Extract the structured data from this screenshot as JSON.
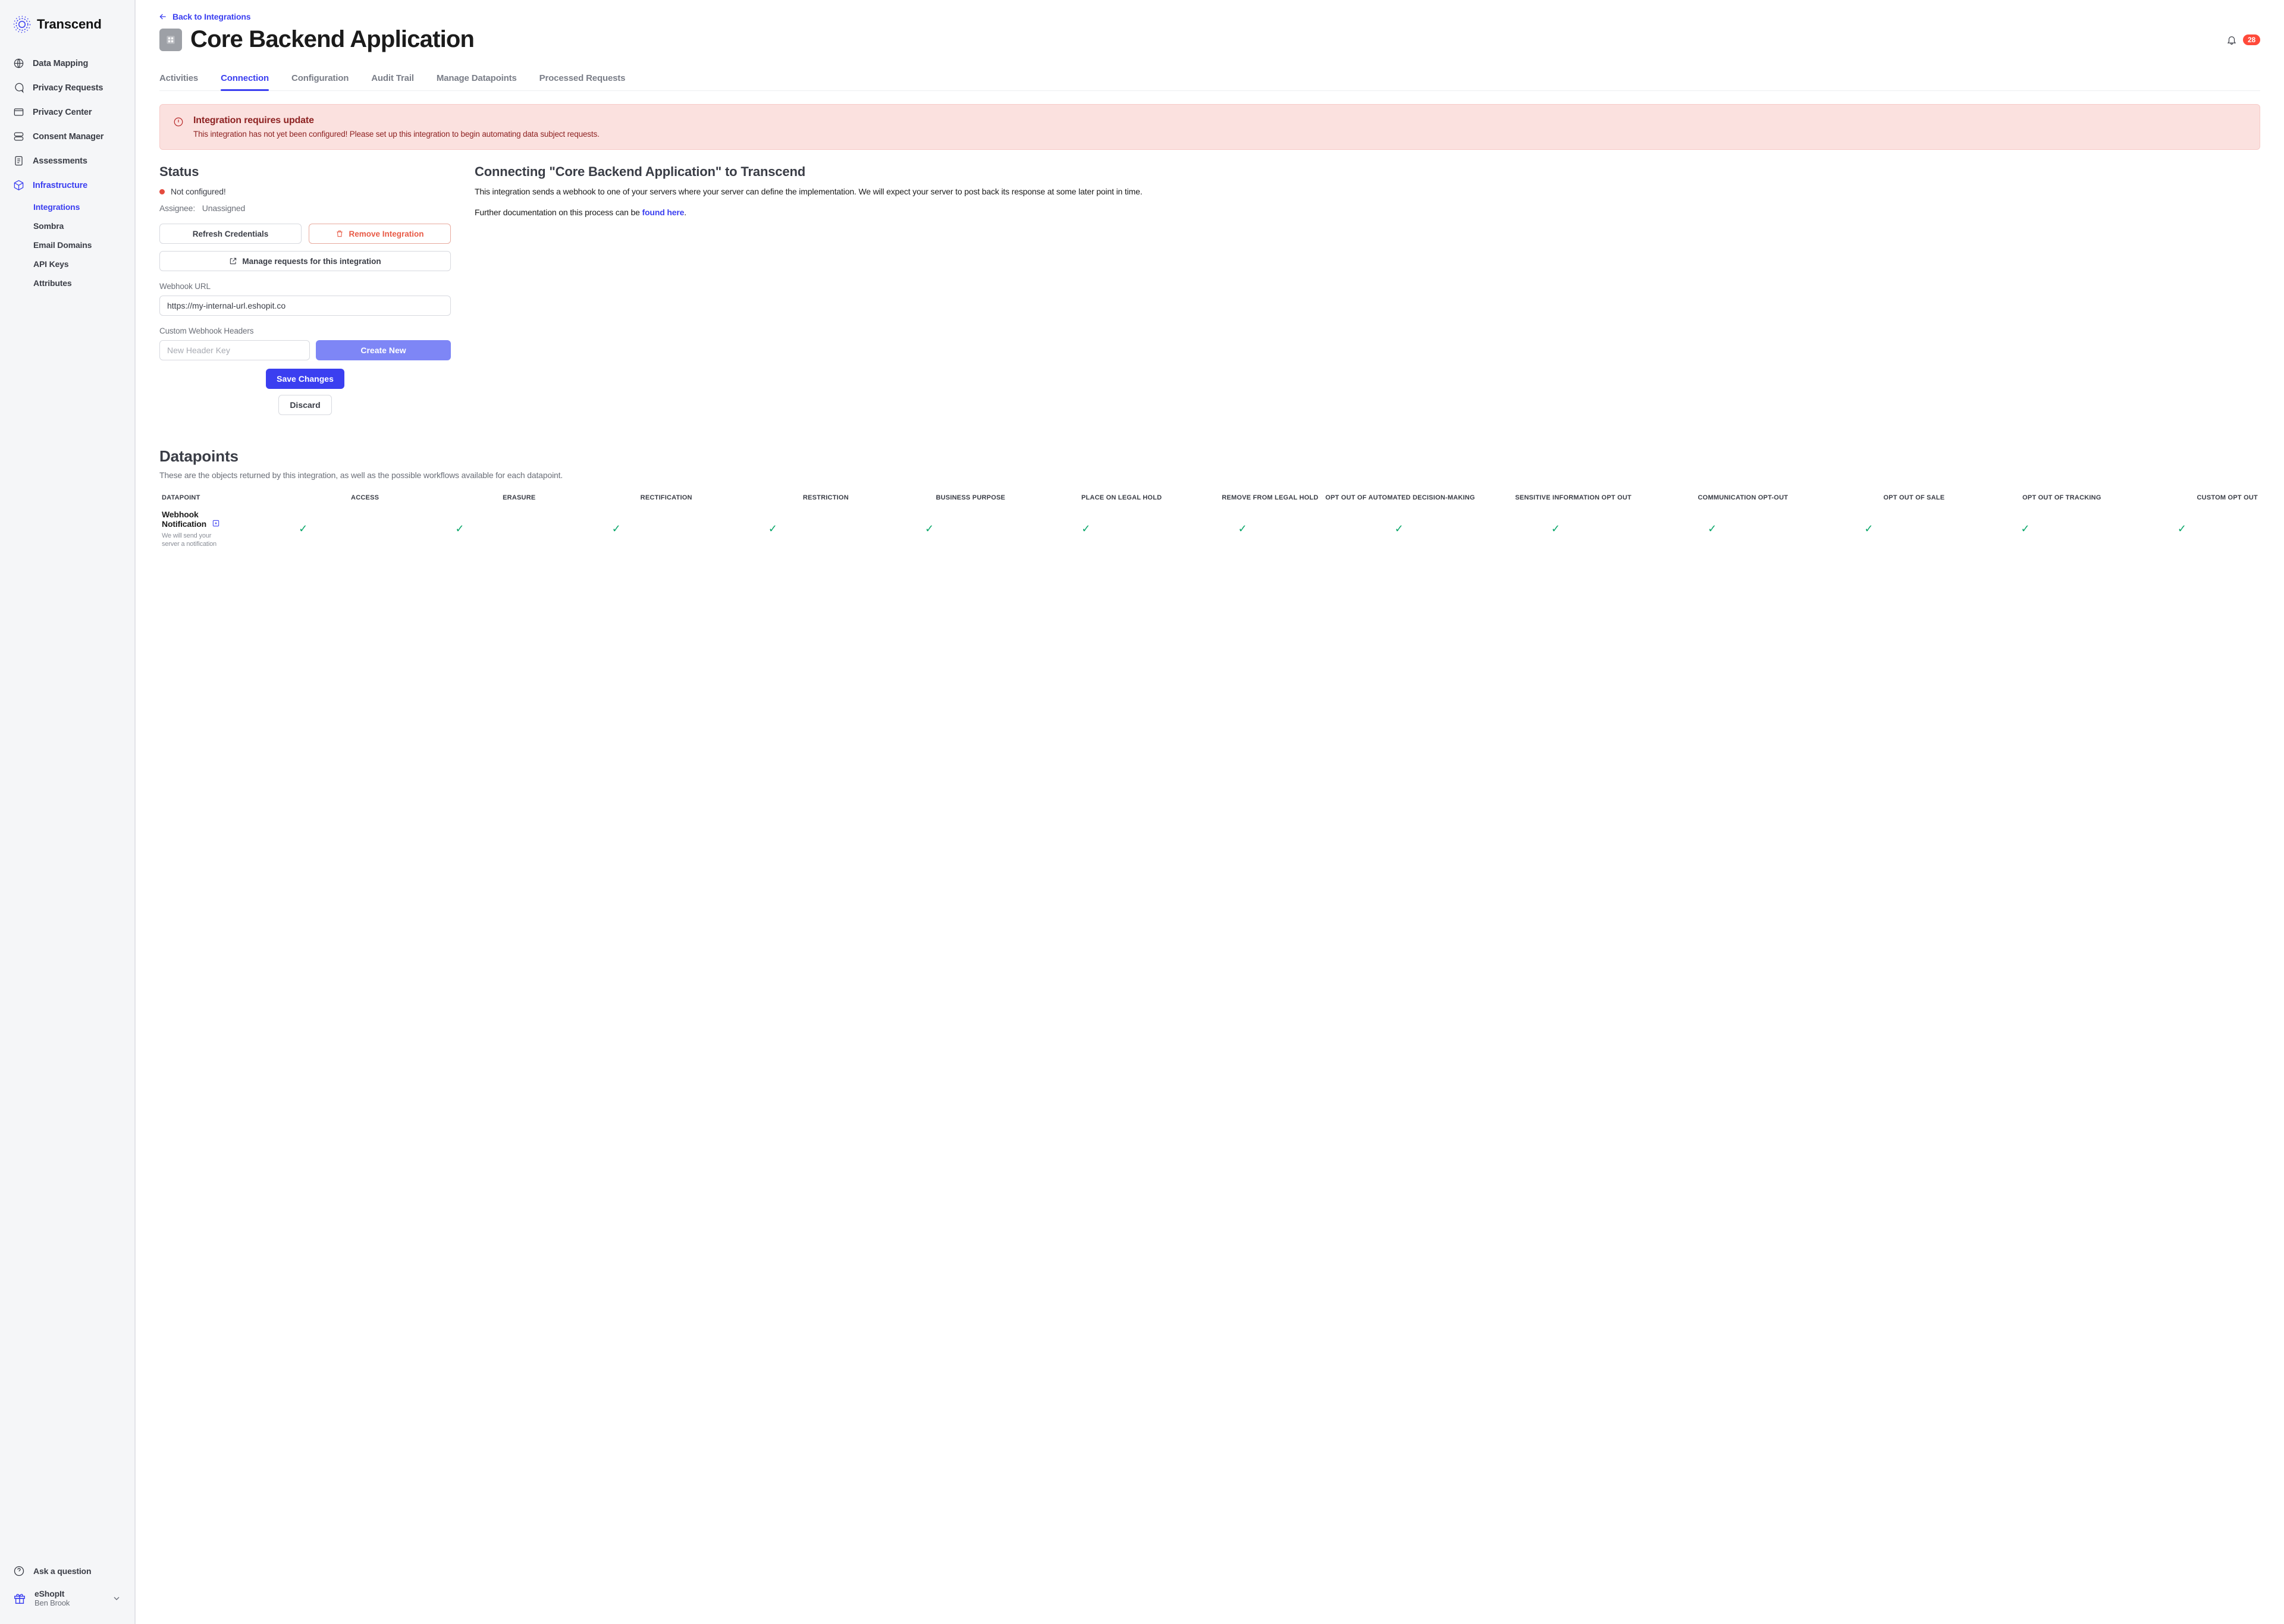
{
  "brand": "Transcend",
  "sidebar": {
    "items": [
      {
        "label": "Data Mapping"
      },
      {
        "label": "Privacy Requests"
      },
      {
        "label": "Privacy Center"
      },
      {
        "label": "Consent Manager"
      },
      {
        "label": "Assessments"
      },
      {
        "label": "Infrastructure"
      }
    ],
    "sub": [
      {
        "label": "Integrations"
      },
      {
        "label": "Sombra"
      },
      {
        "label": "Email Domains"
      },
      {
        "label": "API Keys"
      },
      {
        "label": "Attributes"
      }
    ],
    "ask": "Ask a question",
    "org": "eShopIt",
    "user": "Ben Brook"
  },
  "backlink": "Back to Integrations",
  "page_title": "Core Backend Application",
  "notif_count": "28",
  "tabs": [
    "Activities",
    "Connection",
    "Configuration",
    "Audit Trail",
    "Manage Datapoints",
    "Processed Requests"
  ],
  "alert": {
    "title": "Integration requires update",
    "body": "This integration has not yet been configured! Please set up this integration to begin automating data subject requests."
  },
  "status": {
    "heading": "Status",
    "text": "Not configured!",
    "assignee_label": "Assignee:",
    "assignee_value": "Unassigned",
    "refresh": "Refresh Credentials",
    "remove": "Remove Integration",
    "manage": "Manage requests for this integration",
    "webhook_label": "Webhook URL",
    "webhook_value": "https://my-internal-url.eshopit.co",
    "headers_label": "Custom Webhook Headers",
    "header_placeholder": "New Header Key",
    "create_new": "Create New",
    "save": "Save Changes",
    "discard": "Discard"
  },
  "connect": {
    "heading": "Connecting \"Core Backend Application\" to Transcend",
    "p1": "This integration sends a webhook to one of your servers where your server can define the implementation. We will expect your server to post back its response at some later point in time.",
    "p2_pre": "Further documentation on this process can be ",
    "p2_link": "found here",
    "p2_post": "."
  },
  "datapoints": {
    "heading": "Datapoints",
    "sub": "These are the objects returned by this integration, as well as the possible workflows available for each datapoint.",
    "columns": [
      "DATAPOINT",
      "ACCESS",
      "ERASURE",
      "RECTIFICATION",
      "RESTRICTION",
      "BUSINESS PURPOSE",
      "PLACE ON LEGAL HOLD",
      "REMOVE FROM LEGAL HOLD",
      "OPT OUT OF AUTOMATED DECISION-MAKING",
      "SENSITIVE INFORMATION OPT OUT",
      "COMMUNICATION OPT-OUT",
      "OPT OUT OF SALE",
      "OPT OUT OF TRACKING",
      "CUSTOM OPT OUT"
    ],
    "row": {
      "name": "Webhook Notification",
      "desc": "We will send your server a notification"
    }
  }
}
